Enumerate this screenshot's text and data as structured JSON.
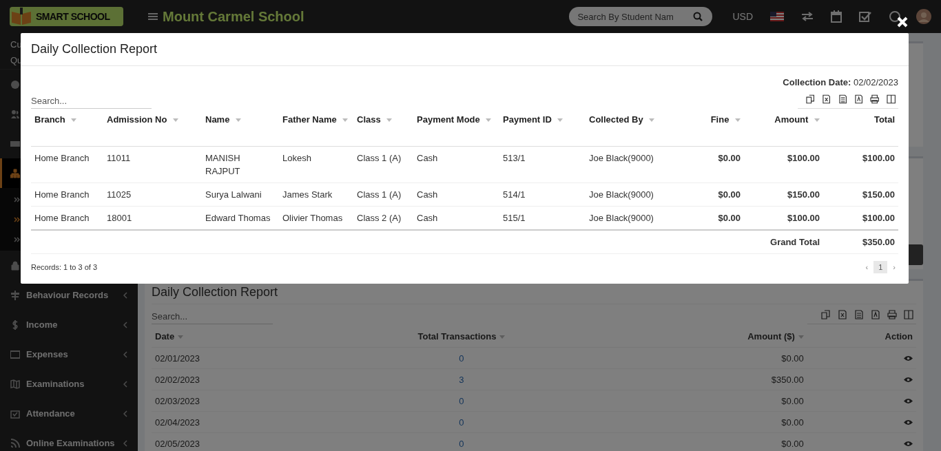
{
  "header": {
    "logo": "SMART SCHOOL",
    "school_name": "Mount Carmel School",
    "search": {
      "placeholder": "Search By Student Nam"
    },
    "currency": "USD"
  },
  "sidebar": {
    "top_texts": [
      "Cu",
      "Qu"
    ],
    "items": [
      {
        "active": false
      },
      {
        "active": false
      },
      {
        "active": false
      },
      {
        "active": true,
        "children": [
          {
            "active": false
          },
          {
            "active": true
          },
          {
            "active": false
          }
        ]
      },
      {
        "active": false
      },
      {
        "label": "Behaviour Records",
        "active": false
      },
      {
        "label": "Income",
        "active": false
      },
      {
        "label": "Expenses",
        "active": false
      },
      {
        "label": "Examinations",
        "active": false
      },
      {
        "label": "Attendance",
        "active": false
      },
      {
        "label": "Online Examinations",
        "active": false
      }
    ]
  },
  "report_card": {
    "title": "Daily Collection Report",
    "search": {
      "placeholder": "Search..."
    },
    "columns": [
      {
        "label": "Date",
        "sortable": true
      },
      {
        "label": "Total Transactions",
        "sortable": true
      },
      {
        "label": "Amount ($)",
        "sortable": true
      },
      {
        "label": "Action",
        "sortable": false
      }
    ],
    "rows": [
      {
        "date": "02/01/2023",
        "transactions": "0",
        "amount": "$0.00"
      },
      {
        "date": "02/02/2023",
        "transactions": "3",
        "amount": "$350.00"
      },
      {
        "date": "02/03/2023",
        "transactions": "0",
        "amount": "$0.00"
      },
      {
        "date": "02/04/2023",
        "transactions": "0",
        "amount": "$0.00"
      },
      {
        "date": "02/05/2023",
        "transactions": "0",
        "amount": "$0.00"
      }
    ]
  },
  "modal": {
    "title": "Daily Collection Report",
    "collection_date_label": "Collection Date:",
    "collection_date": "02/02/2023",
    "search": {
      "placeholder": "Search..."
    },
    "columns": [
      {
        "label": "Branch",
        "sortable": true
      },
      {
        "label": "Admission No",
        "sortable": true
      },
      {
        "label": "Name",
        "sortable": true
      },
      {
        "label": "Father Name",
        "sortable": true
      },
      {
        "label": "Class",
        "sortable": true
      },
      {
        "label": "Payment Mode",
        "sortable": true
      },
      {
        "label": "Payment ID",
        "sortable": true
      },
      {
        "label": "Collected By",
        "sortable": true
      },
      {
        "label": "Fine",
        "sortable": true
      },
      {
        "label": "Amount",
        "sortable": true
      },
      {
        "label": "Total",
        "sortable": false
      }
    ],
    "rows": [
      [
        "Home Branch",
        "11011",
        "MANISH RAJPUT",
        "Lokesh",
        "Class 1 (A)",
        "Cash",
        "513/1",
        "Joe Black(9000)",
        "$0.00",
        "$100.00",
        "$100.00"
      ],
      [
        "Home Branch",
        "11025",
        "Surya Lalwani",
        "James Stark",
        "Class 1 (A)",
        "Cash",
        "514/1",
        "Joe Black(9000)",
        "$0.00",
        "$150.00",
        "$150.00"
      ],
      [
        "Home Branch",
        "18001",
        "Edward Thomas",
        "Olivier Thomas",
        "Class 2 (A)",
        "Cash",
        "515/1",
        "Joe Black(9000)",
        "$0.00",
        "$100.00",
        "$100.00"
      ]
    ],
    "grand_total_label": "Grand Total",
    "grand_total": "$350.00",
    "records_text": "Records: 1 to 3 of 3",
    "pagination": {
      "prev": "‹",
      "next": "›",
      "pages": [
        {
          "label": "1",
          "selected": true
        }
      ]
    }
  }
}
